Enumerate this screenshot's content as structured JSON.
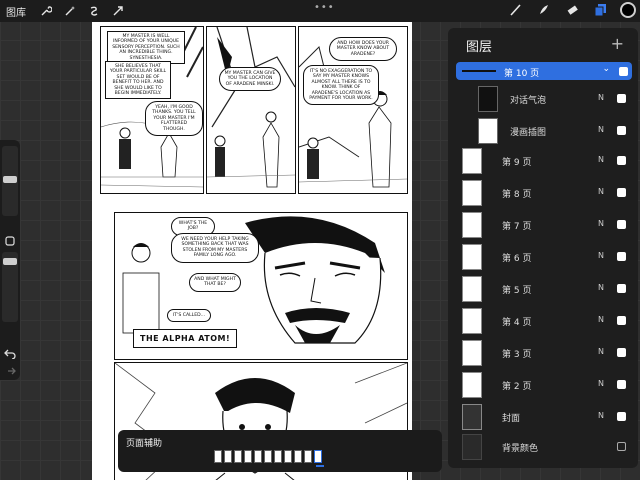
{
  "toolbar": {
    "gallery": "图库",
    "more": "•••",
    "icons": [
      "wrench-icon",
      "magic-wand-icon",
      "selection-icon",
      "transform-arrow-icon"
    ],
    "tools": [
      "brush-icon",
      "smudge-icon",
      "eraser-icon",
      "layers-icon"
    ],
    "active_color": "#000000"
  },
  "comic": {
    "panel1": {
      "caption1": "MY MASTER IS WELL INFORMED OF YOUR UNIQUE SENSORY PERCEPTION. SUCH AN INCREDIBLE THING. SYNESTHESIA.",
      "caption2": "SHE BELIEVES THAT YOUR PARTICULAR SKILL SET WOULD BE OF BENEFIT TO HER. AND SHE WOULD LIKE TO BEGIN IMMEDIATELY.",
      "bubble": "YEAH, I'M GOOD THANKS. YOU TELL YOUR MASTER I'M FLATTERED THOUGH."
    },
    "panel2": {
      "bubble": "MY MASTER CAN GIVE YOU THE LOCATION OF ARADENE MINSKI."
    },
    "panel3": {
      "bubble1": "AND HOW DOES YOUR MASTER KNOW ABOUT ARADENE?",
      "bubble2": "IT'S NO EXAGGERATION TO SAY MY MASTER KNOWS ALMOST ALL THERE IS TO KNOW. THINK OF ARADENE'S LOCATION AS PAYMENT FOR YOUR WORK."
    },
    "panel4": {
      "bubble1": "WHAT'S THE JOB?",
      "bubble2": "WE NEED YOUR HELP TAKING SOMETHING BACK THAT WAS STOLEN FROM MY MASTERS FAMILY LONG AGO.",
      "bubble3": "AND WHAT MIGHT THAT BE?",
      "bubble4": "IT'S CALLED...",
      "callout": "THE ALPHA ATOM!"
    }
  },
  "layers": {
    "title": "图层",
    "add": "+",
    "items": [
      {
        "name": "第 10 页",
        "mode": "",
        "active": true,
        "visible": true
      },
      {
        "name": "对话气泡",
        "mode": "N",
        "sub": true,
        "visible": true
      },
      {
        "name": "漫画插图",
        "mode": "N",
        "sub": true,
        "visible": true
      },
      {
        "name": "第 9 页",
        "mode": "N",
        "visible": true
      },
      {
        "name": "第 8 页",
        "mode": "N",
        "visible": true
      },
      {
        "name": "第 7 页",
        "mode": "N",
        "visible": true
      },
      {
        "name": "第 6 页",
        "mode": "N",
        "visible": true
      },
      {
        "name": "第 5 页",
        "mode": "N",
        "visible": true
      },
      {
        "name": "第 4 页",
        "mode": "N",
        "visible": true
      },
      {
        "name": "第 3 页",
        "mode": "N",
        "visible": true
      },
      {
        "name": "第 2 页",
        "mode": "N",
        "visible": true
      },
      {
        "name": "封面",
        "mode": "N",
        "visible": true
      },
      {
        "name": "背景颜色",
        "mode": "",
        "visible": false
      }
    ]
  },
  "page_assist": {
    "title": "页面辅助",
    "page_count": 11,
    "active_index": 10
  }
}
